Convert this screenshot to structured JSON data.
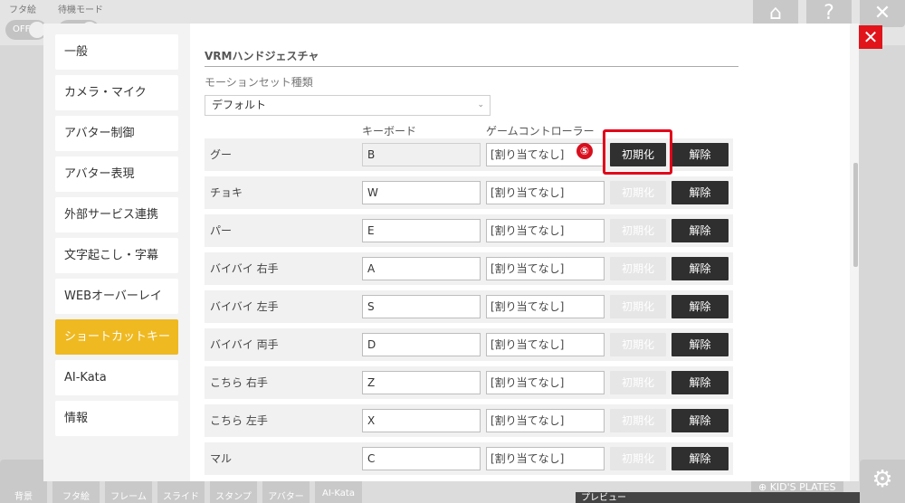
{
  "top_tools": {
    "lid_label": "フタ絵",
    "lid_toggle": "OFF",
    "standby_label": "待機モード"
  },
  "top_right": {
    "home_icon": "home-icon",
    "help_icon": "help-icon",
    "close_icon": "close-icon"
  },
  "sidebar": {
    "items": [
      {
        "label": "一般"
      },
      {
        "label": "カメラ・マイク"
      },
      {
        "label": "アバター制御"
      },
      {
        "label": "アバター表現"
      },
      {
        "label": "外部サービス連携"
      },
      {
        "label": "文字起こし・字幕"
      },
      {
        "label": "WEBオーバーレイ"
      },
      {
        "label": "ショートカットキー",
        "active": true
      },
      {
        "label": "AI-Kata"
      },
      {
        "label": "情報"
      }
    ]
  },
  "section": {
    "title": "VRMハンドジェスチャ",
    "motion_label": "モーションセット種類",
    "motion_value": "デフォルト"
  },
  "columns": {
    "keyboard": "キーボード",
    "gamepad": "ゲームコントローラー"
  },
  "buttons": {
    "init": "初期化",
    "clear": "解除"
  },
  "rows": [
    {
      "label": "グー",
      "key": "B",
      "pad": "[割り当てなし]"
    },
    {
      "label": "チョキ",
      "key": "W",
      "pad": "[割り当てなし]"
    },
    {
      "label": "パー",
      "key": "E",
      "pad": "[割り当てなし]"
    },
    {
      "label": "バイバイ 右手",
      "key": "A",
      "pad": "[割り当てなし]"
    },
    {
      "label": "バイバイ 左手",
      "key": "S",
      "pad": "[割り当てなし]"
    },
    {
      "label": "バイバイ 両手",
      "key": "D",
      "pad": "[割り当てなし]"
    },
    {
      "label": "こちら 右手",
      "key": "Z",
      "pad": "[割り当てなし]"
    },
    {
      "label": "こちら 左手",
      "key": "X",
      "pad": "[割り当てなし]"
    },
    {
      "label": "マル",
      "key": "C",
      "pad": "[割り当てなし]"
    }
  ],
  "annotation": {
    "step": "⑤",
    "color": "#e1001a"
  },
  "bottom_bar": {
    "items": [
      "背景",
      "フタ絵",
      "フレーム",
      "スライド",
      "スタンプ",
      "アバター",
      "AI-Kata"
    ],
    "kids_plates": "KID'S PLATES",
    "preview": "プレビュー"
  },
  "colors": {
    "accent": "#efb921",
    "close_red": "#e1141b",
    "dark_button": "#2f2f2f"
  }
}
